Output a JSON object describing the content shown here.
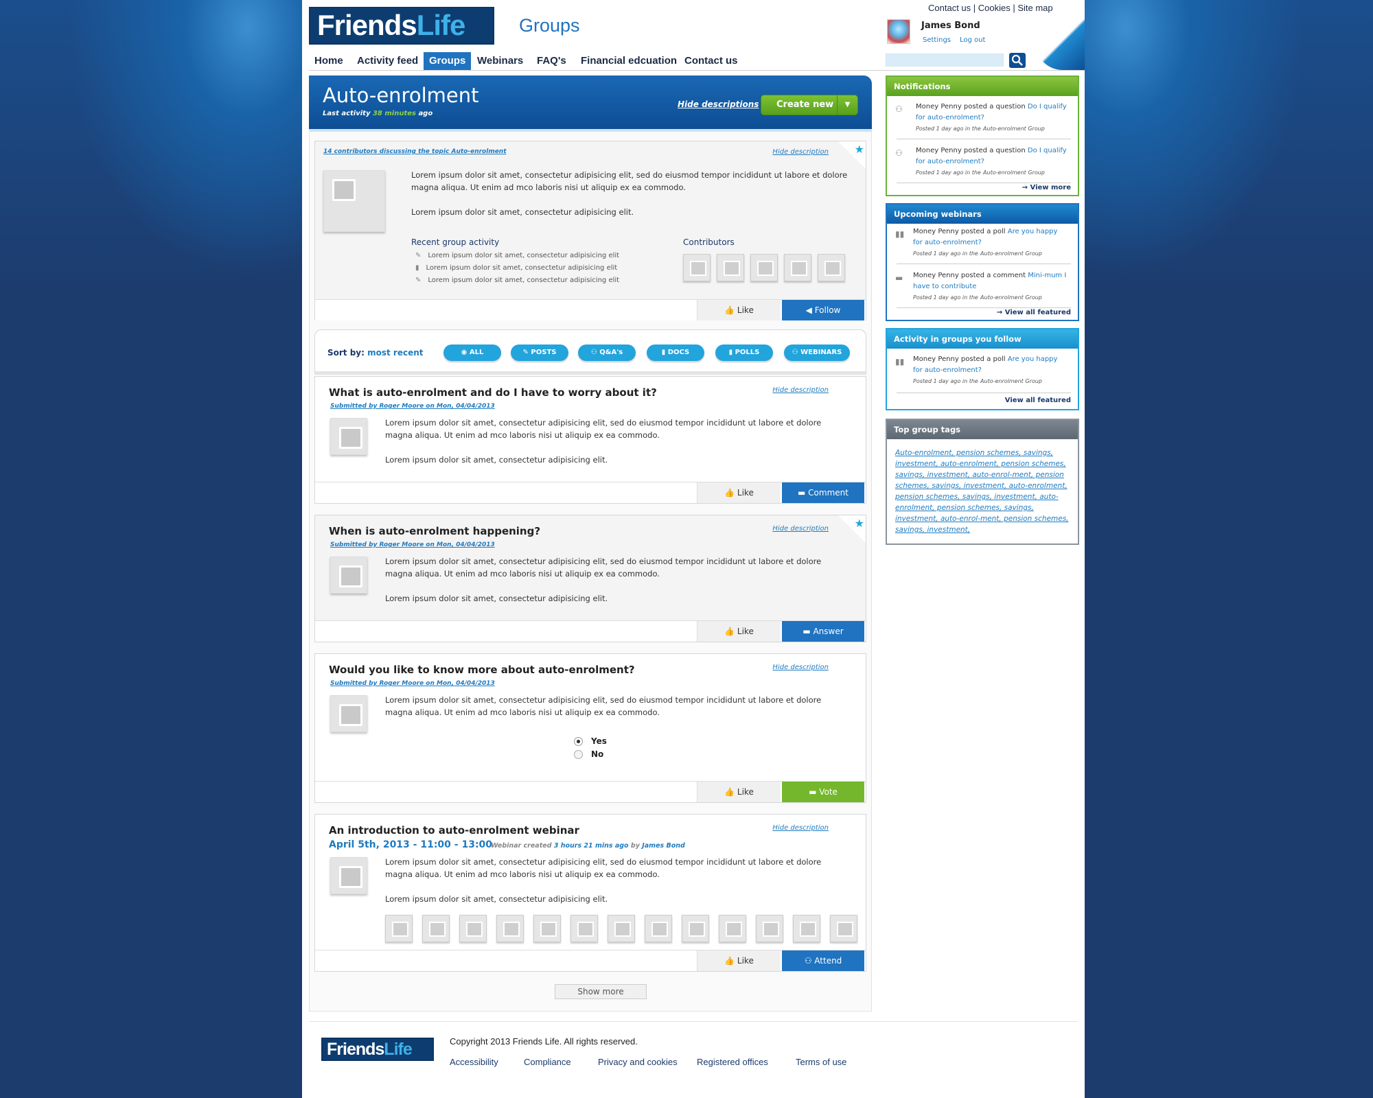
{
  "header": {
    "logo_part1": "Friends",
    "logo_part2": "Life",
    "section": "Groups",
    "top_links": [
      "Contact us",
      "Cookies",
      "Site map"
    ],
    "user_name": "James Bond",
    "settings": "Settings",
    "logout": "Log out",
    "search_placeholder": ""
  },
  "nav": [
    "Home",
    "Activity feed",
    "Groups",
    "Webinars",
    "FAQ's",
    "Financial edcuation",
    "Contact us"
  ],
  "banner": {
    "title": "Auto-enrolment",
    "last_activity_label": "Last activity",
    "last_activity_value": "38 minutes",
    "last_activity_suffix": "ago",
    "hide_descriptions": "Hide descriptions",
    "create_new": "Create new"
  },
  "group": {
    "contributors_link": "14 contributors discussing the topic Auto-enrolment",
    "hide_description": "Hide description",
    "text1": "Lorem ipsum dolor sit amet, consectetur adipisicing elit, sed do eiusmod tempor incididunt ut labore et dolore magna aliqua. Ut enim ad mco laboris nisi ut aliquip ex ea commodo.",
    "text2": "Lorem ipsum dolor sit amet, consectetur adipisicing elit.",
    "recent_title": "Recent group activity",
    "recent": [
      "Lorem ipsum dolor sit amet, consectetur adipisicing elit",
      "Lorem ipsum dolor sit amet, consectetur adipisicing elit",
      "Lorem ipsum dolor sit amet, consectetur adipisicing elit"
    ],
    "contributors_title": "Contributors",
    "like": "Like",
    "follow": "Follow"
  },
  "sort": {
    "label": "Sort by:",
    "value": "most recent",
    "filters": [
      "ALL",
      "POSTS",
      "Q&A's",
      "DOCS",
      "POLLS",
      "WEBINARS"
    ]
  },
  "posts": [
    {
      "title": "What is auto-enrolment and do I have to worry about it?",
      "submitted": "Submitted by Roger Moore on Mon, 04/04/2013",
      "hide": "Hide description",
      "text1": "Lorem ipsum dolor sit amet, consectetur adipisicing elit, sed do eiusmod tempor incididunt ut labore et dolore magna aliqua. Ut enim ad mco laboris nisi ut aliquip ex ea commodo.",
      "text2": "Lorem ipsum dolor sit amet, consectetur adipisicing elit.",
      "like": "Like",
      "action": "Comment"
    },
    {
      "title": "When is auto-enrolment happening?",
      "submitted": "Submitted by Roger Moore on Mon, 04/04/2013",
      "hide": "Hide description",
      "text1": "Lorem ipsum dolor sit amet, consectetur adipisicing elit, sed do eiusmod tempor incididunt ut labore et dolore magna aliqua. Ut enim ad mco laboris nisi ut aliquip ex ea commodo.",
      "text2": "Lorem ipsum dolor sit amet, consectetur adipisicing elit.",
      "like": "Like",
      "action": "Answer"
    },
    {
      "title": "Would you like to know more about auto-enrolment?",
      "submitted": "Submitted by Roger Moore on Mon, 04/04/2013",
      "hide": "Hide description",
      "text1": "Lorem ipsum dolor sit amet, consectetur adipisicing elit, sed do eiusmod tempor incididunt ut labore et dolore magna aliqua. Ut enim ad mco laboris nisi ut aliquip ex ea commodo.",
      "opt_yes": "Yes",
      "opt_no": "No",
      "like": "Like",
      "action": "Vote"
    },
    {
      "title": "An introduction to auto-enrolment webinar",
      "date": "April 5th, 2013 - 11:00 - 13:00",
      "created_label": "Webinar created",
      "created_value": "3 hours 21 mins ago",
      "by_label": "by",
      "by_value": "James Bond",
      "hide": "Hide description",
      "text1": "Lorem ipsum dolor sit amet, consectetur adipisicing elit, sed do eiusmod tempor incididunt ut labore et dolore magna aliqua. Ut enim ad mco laboris nisi ut aliquip ex ea commodo.",
      "text2": "Lorem ipsum dolor sit amet, consectetur adipisicing elit.",
      "like": "Like",
      "action": "Attend"
    }
  ],
  "show_more": "Show more",
  "sidebar": {
    "notifications": {
      "title": "Notifications",
      "items": [
        {
          "who": "Money Penny posted a question",
          "link": "Do I qualify for auto-enrolment?",
          "meta": "Posted 1 day ago in the",
          "group": "Auto-enrolment Group"
        },
        {
          "who": "Money Penny posted a question",
          "link": "Do I qualify for auto-enrolment?",
          "meta": "Posted 1 day ago in the",
          "group": "Auto-enrolment Group"
        }
      ],
      "more": "View more"
    },
    "webinars": {
      "title": "Upcoming webinars",
      "items": [
        {
          "who": "Money Penny posted a poll",
          "link": "Are you happy for auto-enrolment?",
          "meta": "Posted 1 day ago in the",
          "group": "Auto-enrolment Group"
        },
        {
          "who": "Money Penny posted a comment",
          "link": "Mini-mum I have to contribute",
          "meta": "Posted 1 day ago in the",
          "group": "Auto-enrolment Group"
        }
      ],
      "more": "View all featured"
    },
    "activity": {
      "title": "Activity in groups you follow",
      "items": [
        {
          "who": "Money Penny posted a poll",
          "link": "Are you happy for auto-enrolment?",
          "meta": "Posted 1 day ago in the",
          "group": "Auto-enrolment Group"
        }
      ],
      "more": "View all featured"
    },
    "tags": {
      "title": "Top group tags",
      "text": "Auto-enrolment, pension schemes, savings, investment, auto-enrolment, pension schemes, savings, investment, auto-enrol-ment, pension schemes, savings, investment, auto-enrolment, pension schemes, savings, investment, auto-enrolment, pension schemes, savings, investment, auto-enrol-ment, pension schemes, savings, investment,"
    }
  },
  "footer": {
    "logo_part1": "Friends",
    "logo_part2": "Life",
    "copyright": "Copyright 2013 Friends Life. All rights reserved.",
    "links": [
      "Accessibility",
      "Compliance",
      "Privacy and cookies",
      "Registered offices",
      "Terms of use"
    ]
  }
}
